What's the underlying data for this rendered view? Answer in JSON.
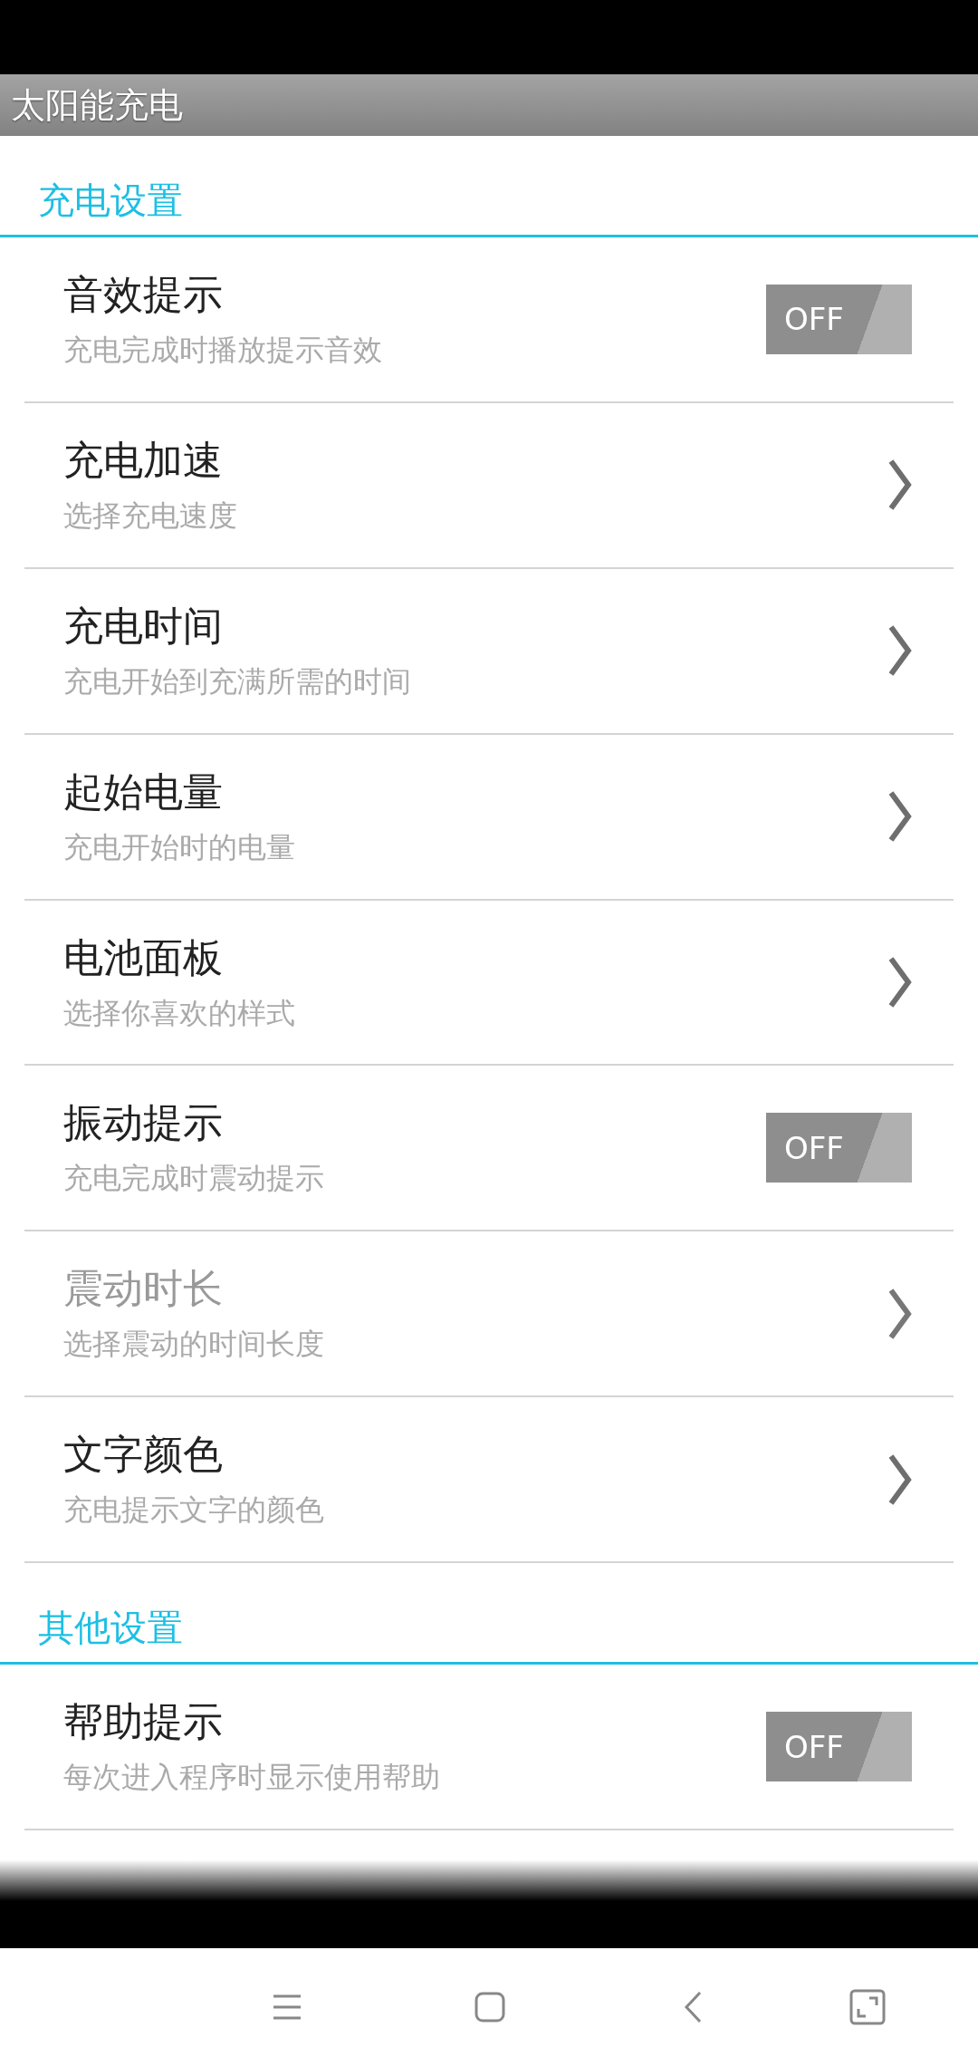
{
  "app_bar": {
    "title": "太阳能充电"
  },
  "sections": [
    {
      "header": "充电设置",
      "items": [
        {
          "kind": "toggle",
          "title": "音效提示",
          "summary": "充电完成时播放提示音效",
          "disabled": false,
          "on": false,
          "toggle_label": "OFF"
        },
        {
          "kind": "link",
          "title": "充电加速",
          "summary": "选择充电速度",
          "disabled": false
        },
        {
          "kind": "link",
          "title": "充电时间",
          "summary": "充电开始到充满所需的时间",
          "disabled": false
        },
        {
          "kind": "link",
          "title": "起始电量",
          "summary": "充电开始时的电量",
          "disabled": false
        },
        {
          "kind": "link",
          "title": "电池面板",
          "summary": "选择你喜欢的样式",
          "disabled": false
        },
        {
          "kind": "toggle",
          "title": "振动提示",
          "summary": "充电完成时震动提示",
          "disabled": false,
          "on": false,
          "toggle_label": "OFF"
        },
        {
          "kind": "link",
          "title": "震动时长",
          "summary": "选择震动的时间长度",
          "disabled": true
        },
        {
          "kind": "link",
          "title": "文字颜色",
          "summary": "充电提示文字的颜色",
          "disabled": false
        }
      ]
    },
    {
      "header": "其他设置",
      "items": [
        {
          "kind": "toggle",
          "title": "帮助提示",
          "summary": "每次进入程序时显示使用帮助",
          "disabled": false,
          "on": false,
          "toggle_label": "OFF"
        }
      ]
    }
  ]
}
